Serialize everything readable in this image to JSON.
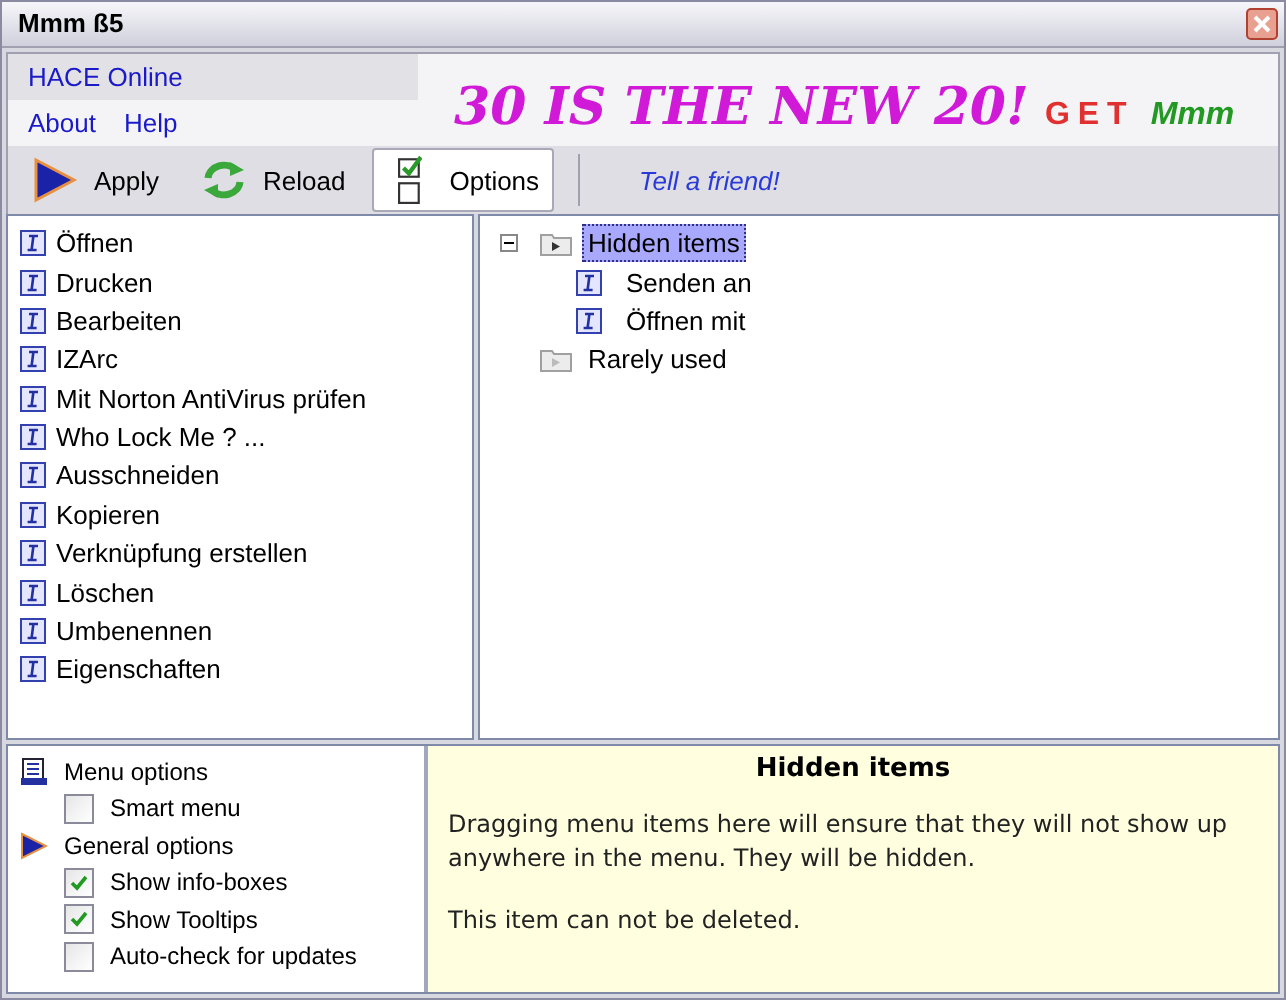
{
  "window": {
    "title": "Mmm ß5"
  },
  "menu": {
    "rows": [
      [
        "HACE Online"
      ],
      [
        "About",
        "Help"
      ]
    ]
  },
  "banner": {
    "headline": "30 IS THE NEW 20!",
    "get": "GET",
    "brand": "Mmm"
  },
  "toolbar": {
    "buttons": [
      {
        "label": "Apply",
        "kind": "apply",
        "selected": false
      },
      {
        "label": "Reload",
        "kind": "reload",
        "selected": false
      },
      {
        "label": "Options",
        "kind": "options",
        "selected": true
      }
    ],
    "link": "Tell a friend!"
  },
  "menu_items": [
    "Öffnen",
    "Drucken",
    "Bearbeiten",
    "IZArc",
    "Mit Norton AntiVirus prüfen",
    "Who Lock Me ? ...",
    "Ausschneiden",
    "Kopieren",
    "Verknüpfung erstellen",
    "Löschen",
    "Umbenennen",
    "Eigenschaften"
  ],
  "tree": [
    {
      "label": "Hidden items",
      "kind": "folder",
      "expanded": true,
      "selected": true,
      "children": [
        {
          "label": "Senden an",
          "kind": "item",
          "selected": false
        },
        {
          "label": "Öffnen mit",
          "kind": "item",
          "selected": false
        }
      ]
    },
    {
      "label": "Rarely used",
      "kind": "folder",
      "selected": false
    }
  ],
  "options": [
    {
      "label": "Menu options",
      "kind": "page-section"
    },
    {
      "label": "Smart menu",
      "kind": "checkbox",
      "checked": false
    },
    {
      "label": "General options",
      "kind": "arrow-section"
    },
    {
      "label": "Show info-boxes",
      "kind": "checkbox",
      "checked": true
    },
    {
      "label": "Show Tooltips",
      "kind": "checkbox",
      "checked": true
    },
    {
      "label": "Auto-check for updates",
      "kind": "checkbox",
      "checked": false
    }
  ],
  "info": {
    "title": "Hidden items",
    "paragraphs": [
      "Dragging menu items here will ensure that they will not show up anywhere in the menu. They will be hidden.",
      "This item can not be deleted."
    ]
  }
}
